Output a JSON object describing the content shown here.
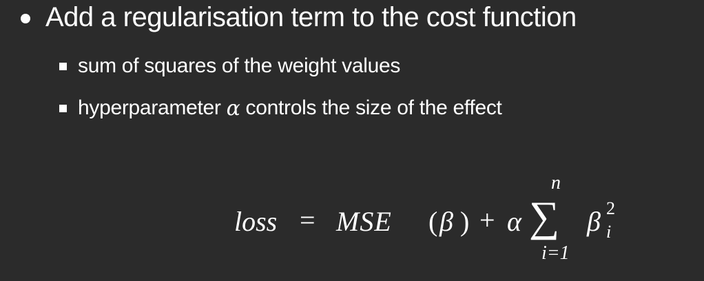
{
  "slide": {
    "bullet_main": "Add a regularisation term to the cost function",
    "sub_bullets": [
      {
        "text": "sum of squares of the weight values"
      },
      {
        "before": "hyperparameter",
        "symbol": "α",
        "after": "controls the size of the effect"
      }
    ],
    "formula": {
      "lhs": "loss",
      "equals": "=",
      "mse": "MSE",
      "paren_open": "(",
      "beta": "β",
      "paren_close": ")",
      "plus": "+",
      "alpha": "α",
      "sigma": "∑",
      "upper_limit": "n",
      "lower_limit": "i=1",
      "summand": "β",
      "superscript": "2",
      "subscript": "i"
    }
  },
  "colors": {
    "background": "#2b2b2b",
    "text": "#ffffff"
  }
}
